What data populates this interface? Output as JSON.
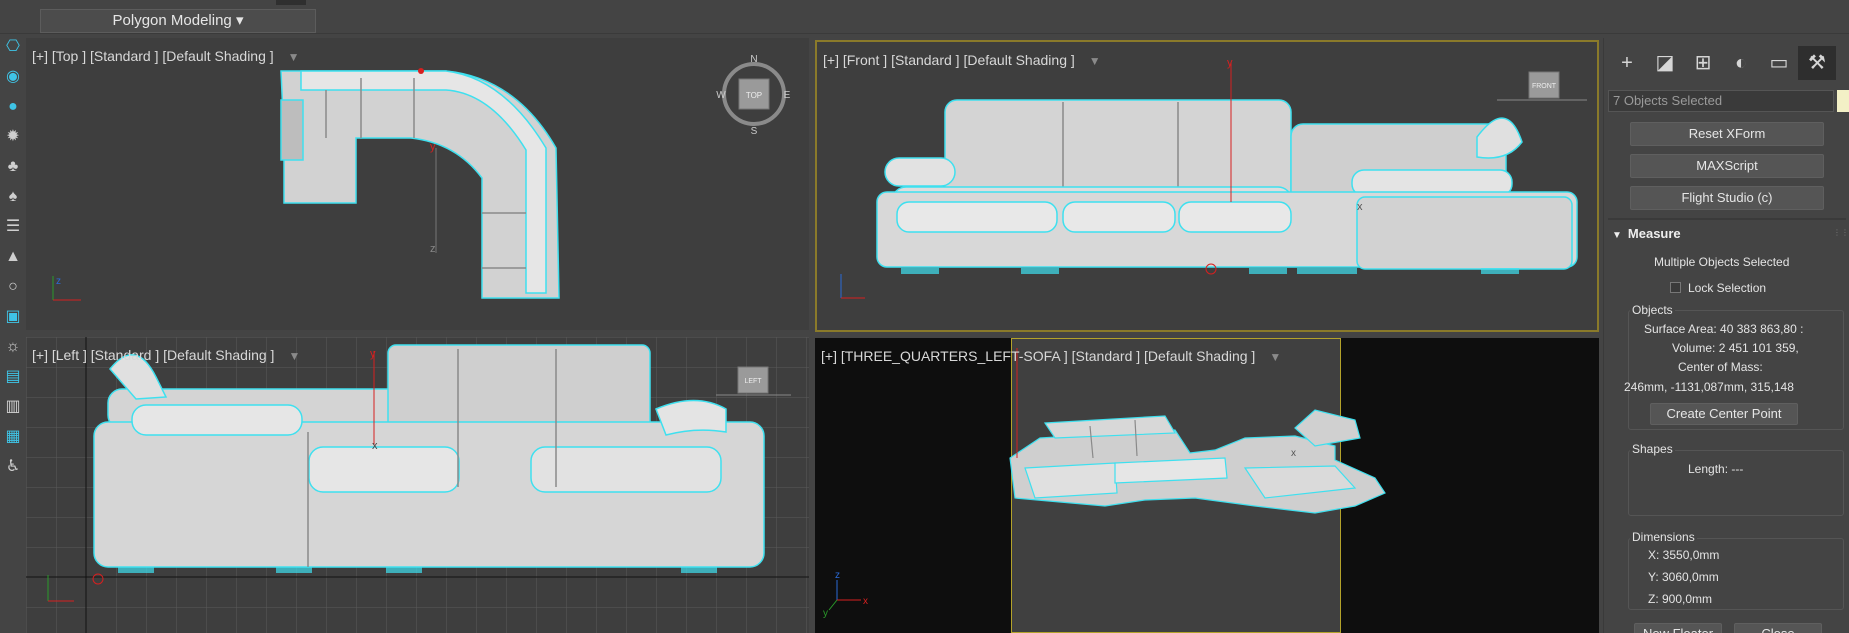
{
  "toolbar": {
    "workspace_label": "Polygon Modeling"
  },
  "viewports": {
    "top": {
      "label": "[+] [Top ] [Standard ] [Default Shading ]",
      "viewcube": "TOP",
      "compass": {
        "n": "N",
        "s": "S",
        "e": "E",
        "w": "W"
      },
      "axis_y": "y",
      "axis_z": "z"
    },
    "front": {
      "label": "[+] [Front ] [Standard ] [Default Shading ]",
      "viewcube": "FRONT",
      "axis_y": "y",
      "axis_x": "x"
    },
    "left": {
      "label": "[+] [Left ] [Standard ] [Default Shading ]",
      "viewcube": "LEFT",
      "axis_y": "y",
      "axis_x": "x"
    },
    "perspective": {
      "label": "[+] [THREE_QUARTERS_LEFT-SOFA ] [Standard ] [Default Shading ]",
      "axis_y": "y",
      "axis_x": "x",
      "axis_z": "z"
    }
  },
  "command_panel": {
    "selection": "7 Objects Selected",
    "buttons": [
      "Reset XForm",
      "MAXScript",
      "Flight Studio (c)"
    ],
    "measure": {
      "title": "Measure",
      "status": "Multiple Objects Selected",
      "lock_selection": "Lock Selection",
      "objects": {
        "title": "Objects",
        "surface_area": "Surface Area:  40 383 863,80 :",
        "volume": "Volume:  2 451 101 359,",
        "center_of_mass_label": "Center of Mass:",
        "center_of_mass_value": "246mm, -1131,087mm, 315,148",
        "create_center_point": "Create Center Point"
      },
      "shapes": {
        "title": "Shapes",
        "length": "Length:  ---"
      },
      "dimensions": {
        "title": "Dimensions",
        "x": "X:   3550,0mm",
        "y": "Y:   3060,0mm",
        "z": "Z:   900,0mm"
      }
    },
    "new_floater": "New Floater",
    "close": "Close"
  },
  "colors": {
    "selection": "#33d6e6",
    "active_border": "#b3a22a",
    "accent_red": "#d62020"
  }
}
